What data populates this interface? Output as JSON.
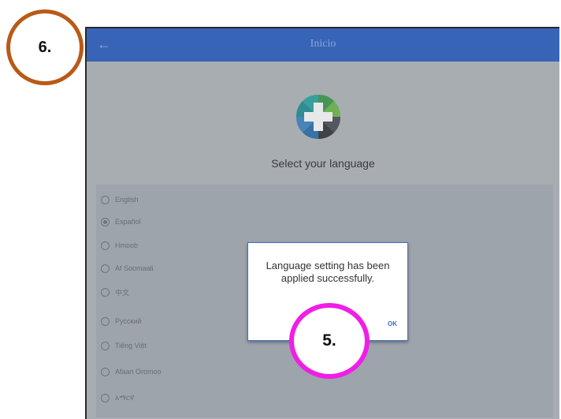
{
  "app": {
    "title": "Inicio",
    "back_icon": "arrow-left-icon",
    "subtitle": "Select your language",
    "colors": {
      "topbar": "#2a5fc2",
      "dialog_border": "#3e74c9",
      "ok": "#3a6fc9"
    }
  },
  "languages": [
    {
      "label": "English",
      "selected": false
    },
    {
      "label": "Español",
      "selected": true
    },
    {
      "label": "Hmoob",
      "selected": false
    },
    {
      "label": "Af Soomaali",
      "selected": false
    },
    {
      "label": "中文",
      "selected": false
    },
    {
      "label": "Русский",
      "selected": false
    },
    {
      "label": "Tiếng Việt",
      "selected": false
    },
    {
      "label": "Afaan Oromoo",
      "selected": false
    },
    {
      "label": "አማርኛ",
      "selected": false
    }
  ],
  "dialog": {
    "message": "Language setting has been applied successfully.",
    "ok_label": "OK"
  },
  "annotations": {
    "step6": "6.",
    "step5": "5.",
    "colors": {
      "step6": "#b85a18",
      "step5": "#f01ee6"
    }
  }
}
